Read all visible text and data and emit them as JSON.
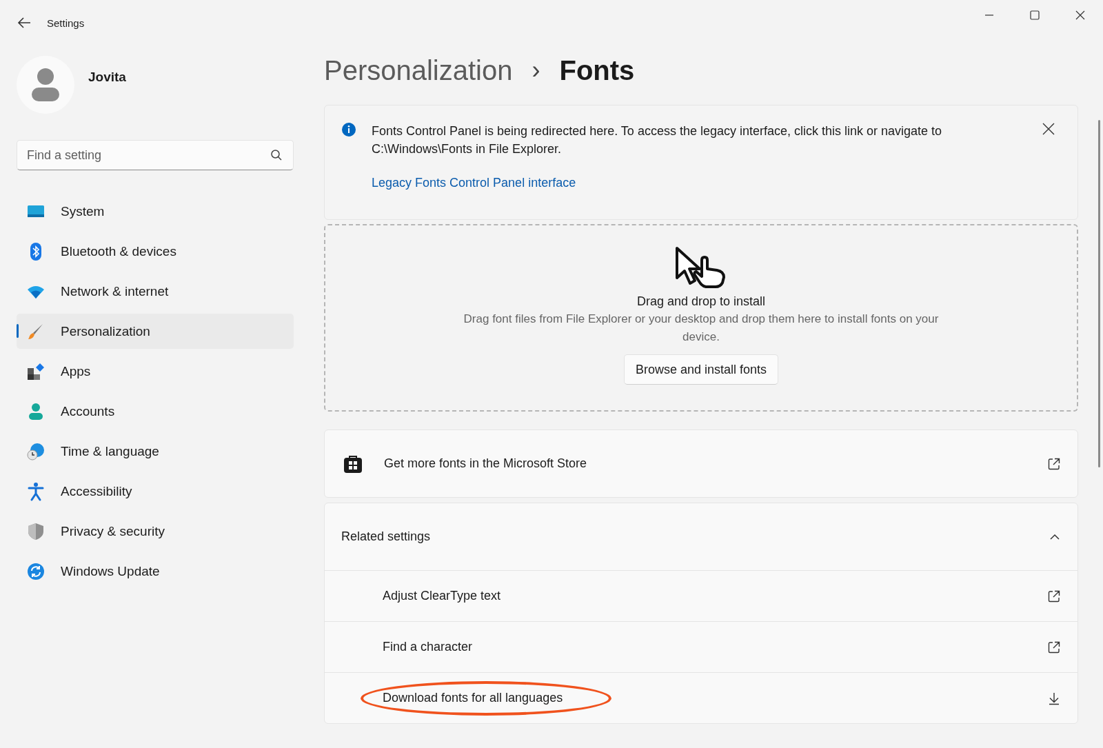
{
  "window": {
    "title": "Settings"
  },
  "user": {
    "name": "Jovita"
  },
  "search": {
    "placeholder": "Find a setting"
  },
  "sidebar": {
    "items": [
      {
        "label": "System",
        "selected": false
      },
      {
        "label": "Bluetooth & devices",
        "selected": false
      },
      {
        "label": "Network & internet",
        "selected": false
      },
      {
        "label": "Personalization",
        "selected": true
      },
      {
        "label": "Apps",
        "selected": false
      },
      {
        "label": "Accounts",
        "selected": false
      },
      {
        "label": "Time & language",
        "selected": false
      },
      {
        "label": "Accessibility",
        "selected": false
      },
      {
        "label": "Privacy & security",
        "selected": false
      },
      {
        "label": "Windows Update",
        "selected": false
      }
    ]
  },
  "breadcrumb": {
    "parent": "Personalization",
    "separator": "›",
    "current": "Fonts"
  },
  "info_bar": {
    "message": "Fonts Control Panel is being redirected here. To access the legacy interface, click this link or navigate to C:\\Windows\\Fonts in File Explorer.",
    "link": "Legacy Fonts Control Panel interface"
  },
  "drop_zone": {
    "title": "Drag and drop to install",
    "description": "Drag font files from File Explorer or your desktop and drop them here to install fonts on your device.",
    "button": "Browse and install fonts"
  },
  "store_link": {
    "label": "Get more fonts in the Microsoft Store"
  },
  "related_settings": {
    "title": "Related settings",
    "expanded": true,
    "items": [
      {
        "label": "Adjust ClearType text",
        "kind": "external",
        "highlighted": false
      },
      {
        "label": "Find a character",
        "kind": "external",
        "highlighted": false
      },
      {
        "label": "Download fonts for all languages",
        "kind": "download",
        "highlighted": true
      }
    ]
  }
}
